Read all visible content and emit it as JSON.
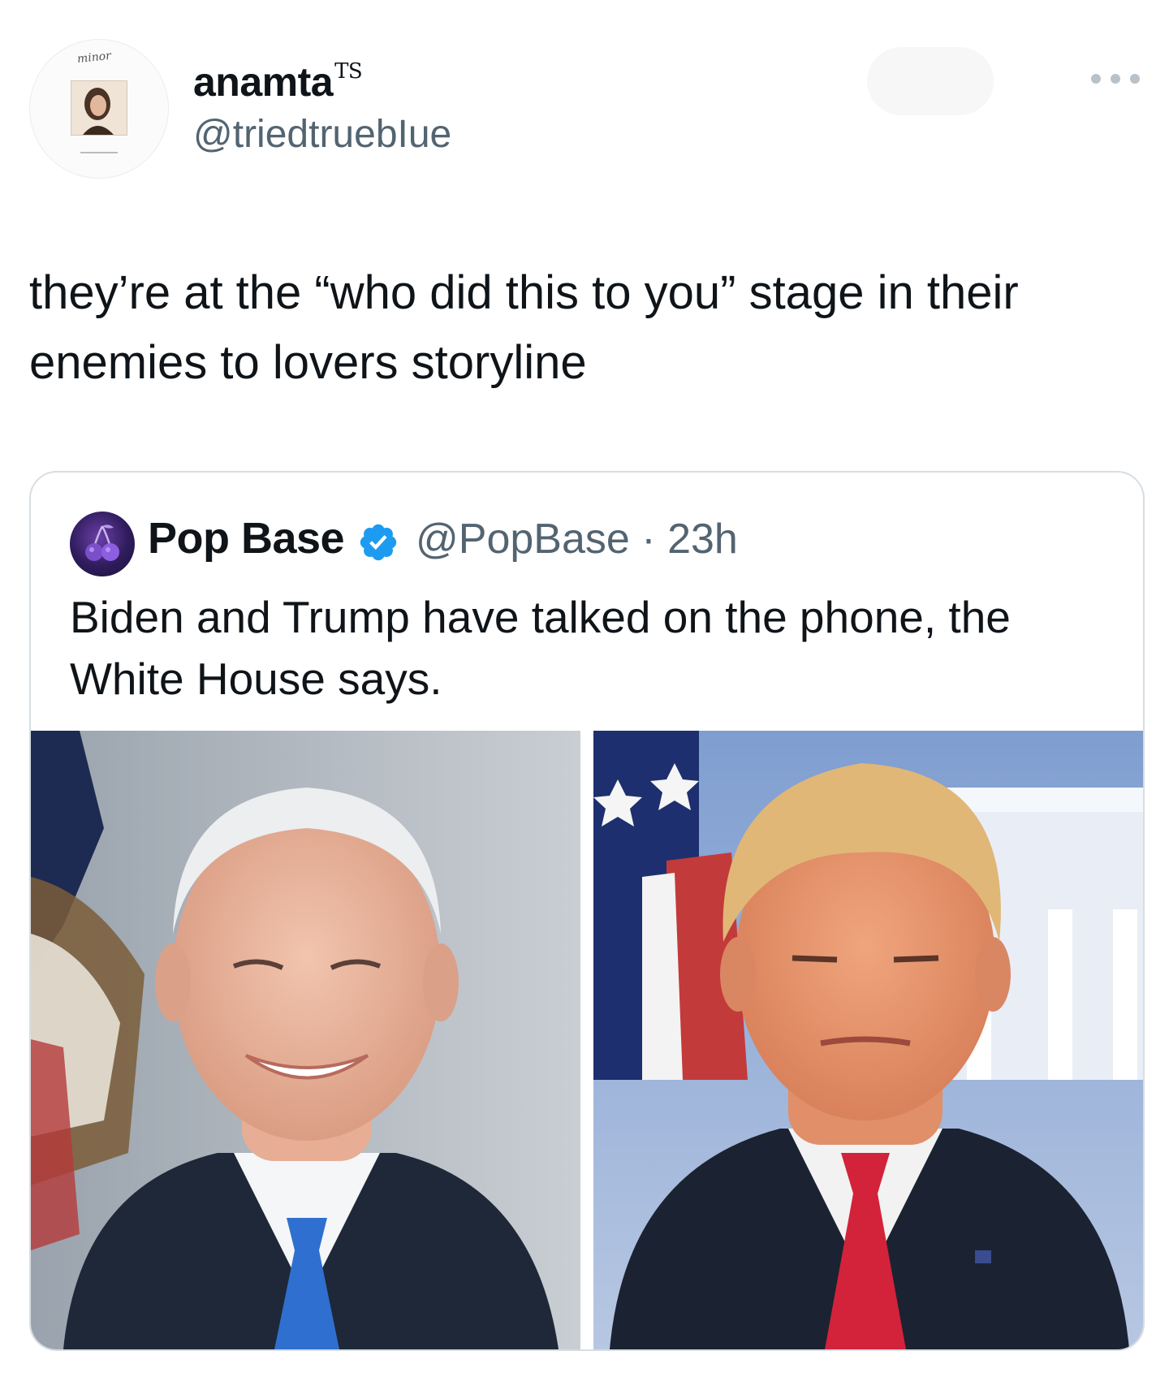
{
  "tweet": {
    "author": {
      "display_name": "anamta",
      "badge": "TS",
      "handle": "@triedtruebIue",
      "avatar_script": "minor"
    },
    "text": "they’re at the “who did this to you” stage in their enemies to lovers storyline"
  },
  "quoted_tweet": {
    "author": {
      "display_name": "Pop Base",
      "verified": true,
      "handle": "@PopBase",
      "time": "23h"
    },
    "text": "Biden and Trump have talked on the phone, the White House says.",
    "media": [
      {
        "subject": "smiling man with white hair, dark suit, blue tie, flag background"
      },
      {
        "subject": "man with blond hair, dark suit, red tie, American flag and White House background"
      }
    ]
  },
  "colors": {
    "primary_text": "#0f1419",
    "secondary_text": "#536471",
    "border": "#d7dee3",
    "verified_blue": "#1d9bf0"
  }
}
